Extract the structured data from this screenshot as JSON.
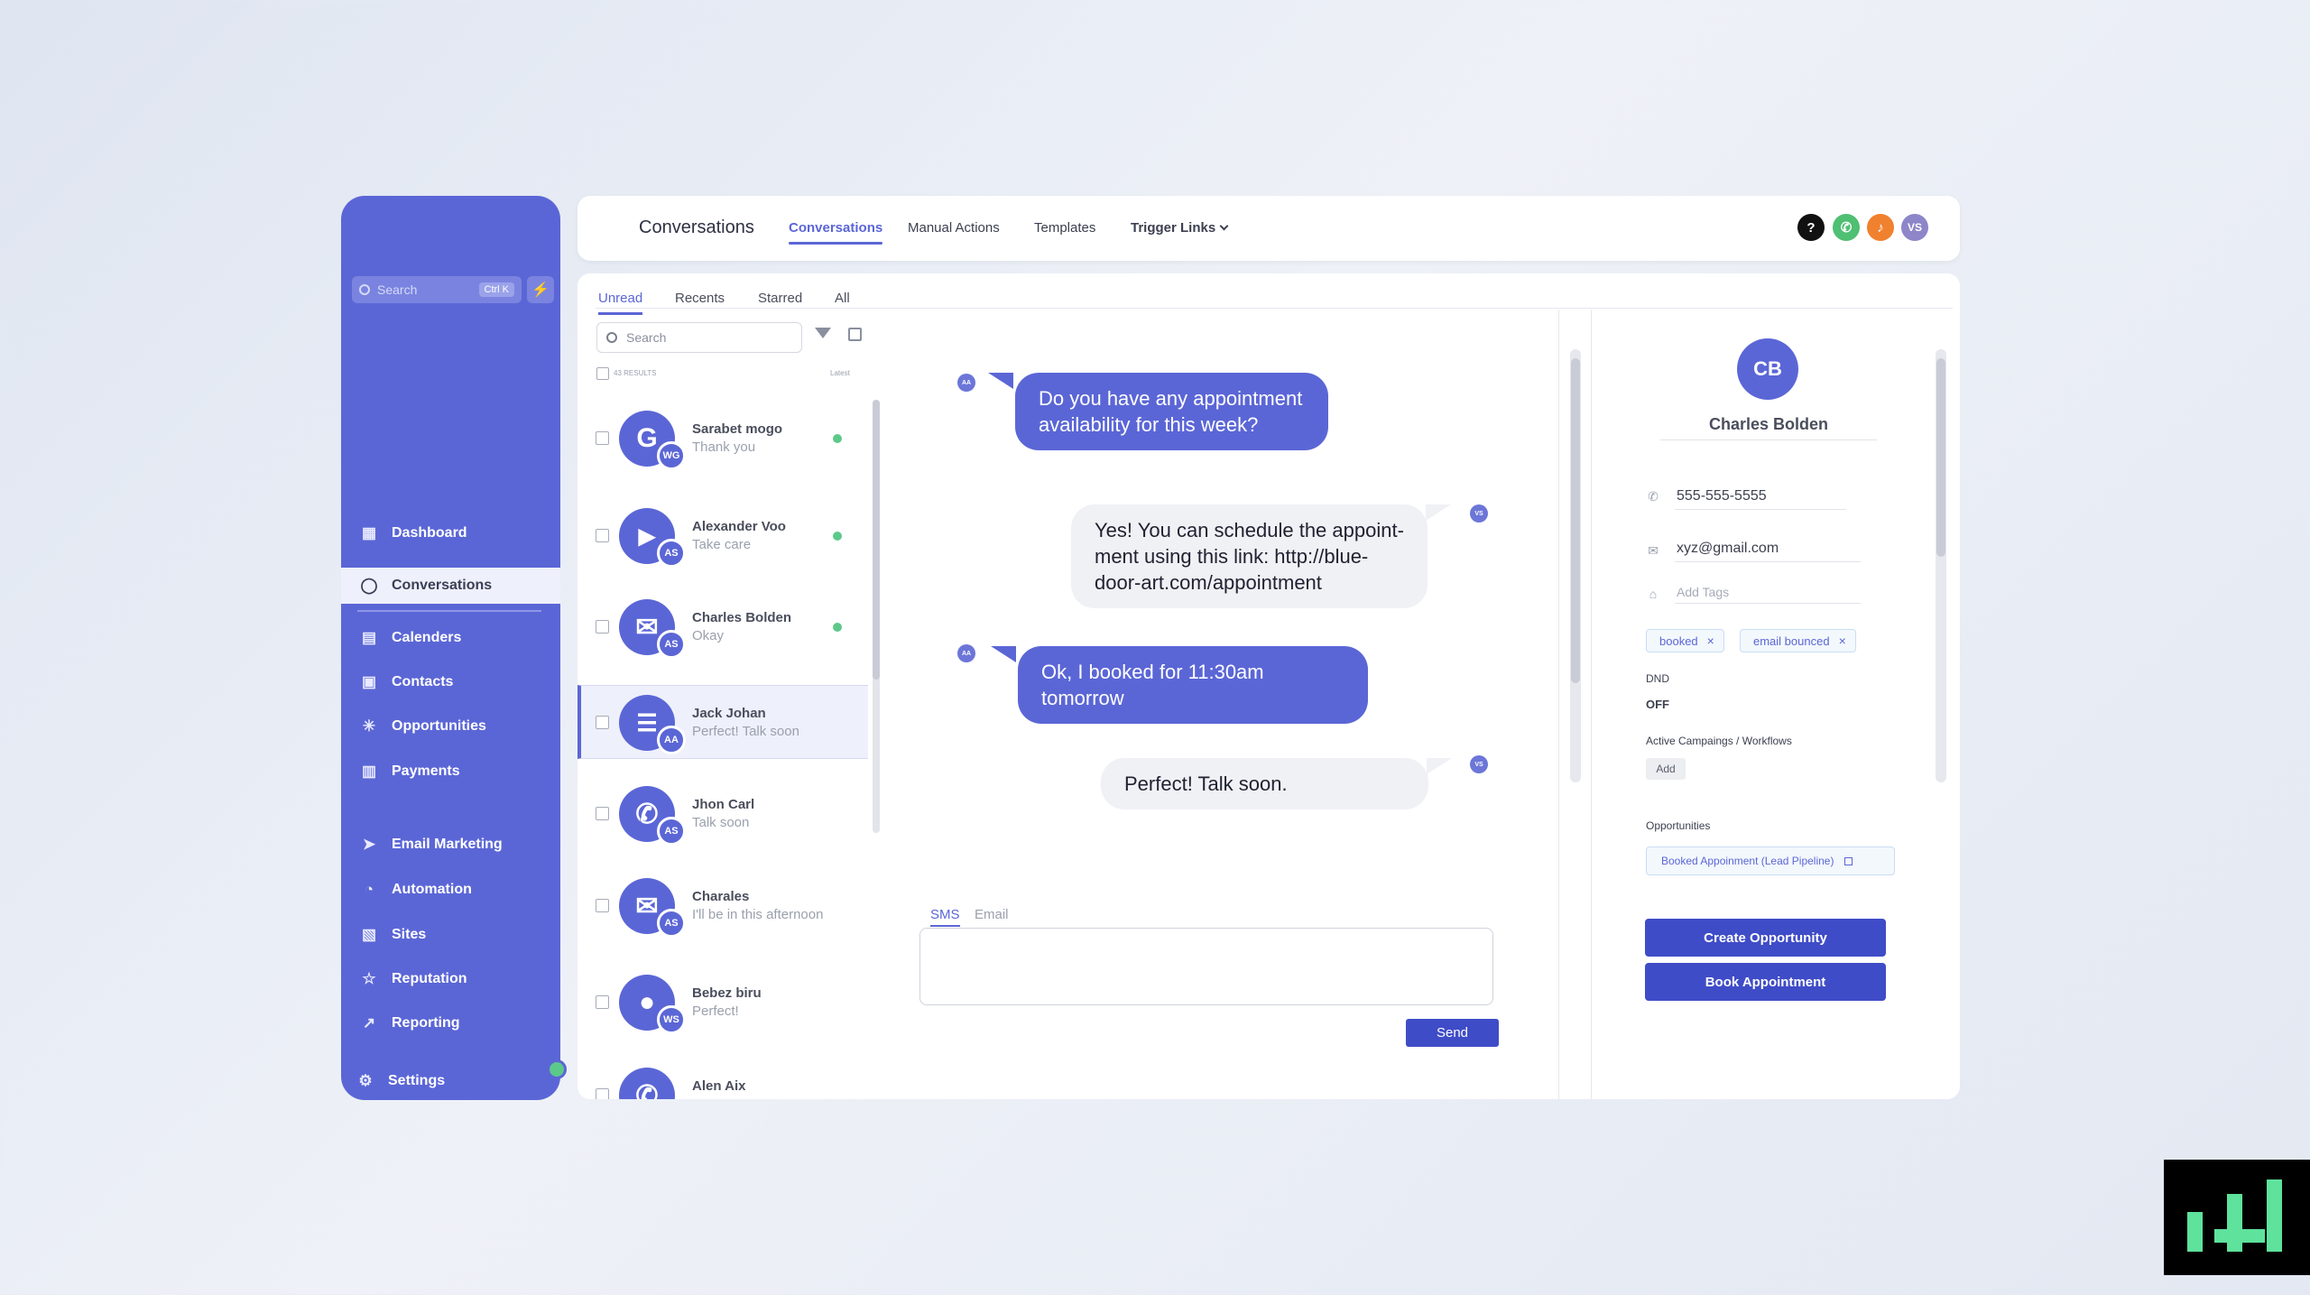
{
  "sidebar": {
    "search_placeholder": "Search",
    "search_shortcut": "Ctrl K",
    "items": [
      {
        "label": "Dashboard",
        "icon": "grid-icon"
      },
      {
        "label": "Conversations",
        "icon": "chat-bubble-icon"
      },
      {
        "label": "Calenders",
        "icon": "calendar-icon"
      },
      {
        "label": "Contacts",
        "icon": "contacts-icon"
      },
      {
        "label": "Opportunities",
        "icon": "opportunities-icon"
      },
      {
        "label": "Payments",
        "icon": "receipt-icon"
      },
      {
        "label": "Email Marketing",
        "icon": "send-icon"
      },
      {
        "label": "Automation",
        "icon": "automation-icon"
      },
      {
        "label": "Sites",
        "icon": "sites-icon"
      },
      {
        "label": "Reputation",
        "icon": "star-icon"
      },
      {
        "label": "Reporting",
        "icon": "trend-icon"
      }
    ],
    "settings_label": "Settings"
  },
  "header": {
    "title": "Conversations",
    "tabs": [
      "Conversations",
      "Manual Actions",
      "Templates",
      "Trigger Links"
    ],
    "user_initials": "VS",
    "help_glyph": "?"
  },
  "list": {
    "tabs": [
      "Unread",
      "Recents",
      "Starred",
      "All"
    ],
    "search_placeholder": "Search",
    "results_label": "43 RESULTS",
    "sort_label": "Latest",
    "conversations": [
      {
        "name": "Sarabet mogo",
        "preview": "Thank you",
        "badge": "WG",
        "glyph": "G"
      },
      {
        "name": "Alexander Voo",
        "preview": "Take care",
        "badge": "AS",
        "glyph": "▶"
      },
      {
        "name": "Charles Bolden",
        "preview": "Okay",
        "badge": "AS",
        "glyph": "✉"
      },
      {
        "name": "Jack Johan",
        "preview": "Perfect! Talk soon",
        "badge": "AA",
        "glyph": "☰"
      },
      {
        "name": "Jhon Carl",
        "preview": "Talk soon",
        "badge": "AS",
        "glyph": "✆"
      },
      {
        "name": "Charales",
        "preview": "I'll be in this afternoon",
        "badge": "AS",
        "glyph": "✉"
      },
      {
        "name": "Bebez biru",
        "preview": "Perfect!",
        "badge": "WS",
        "glyph": "●"
      },
      {
        "name": "Alen Aix",
        "preview": "",
        "badge": "",
        "glyph": "✆"
      }
    ]
  },
  "chat": {
    "messages": [
      {
        "direction": "in",
        "avatar": "AA",
        "text": "Do you have any appointment availability for this week?"
      },
      {
        "direction": "out",
        "avatar": "VS",
        "text": "Yes! You can schedule the appoint-ment using this link: http://blue-door-art.com/appointment"
      },
      {
        "direction": "in",
        "avatar": "AA",
        "text": "Ok, I booked for 11:30am tomorrow"
      },
      {
        "direction": "out",
        "avatar": "VS",
        "text": "Perfect! Talk soon."
      }
    ],
    "compose_tabs": [
      "SMS",
      "Email"
    ],
    "send_label": "Send"
  },
  "contact": {
    "initials": "CB",
    "name": "Charles Bolden",
    "phone": "555-555-5555",
    "email": "xyz@gmail.com",
    "tags_placeholder": "Add Tags",
    "tags": [
      "booked",
      "email bounced"
    ],
    "dnd_label": "DND",
    "dnd_value": "OFF",
    "campaigns_label": "Active Campaings / Workflows",
    "add_label": "Add",
    "opportunities_label": "Opportunities",
    "opportunity": "Booked Appoinment (Lead Pipeline)",
    "create_opportunity_label": "Create Opportunity",
    "book_appointment_label": "Book Appointment"
  },
  "colors": {
    "accent": "#5b66d6",
    "button": "#3f4cc7",
    "online": "#5cc98a",
    "phone_icon": "#4fbf73",
    "bell_icon": "#f0812e"
  }
}
